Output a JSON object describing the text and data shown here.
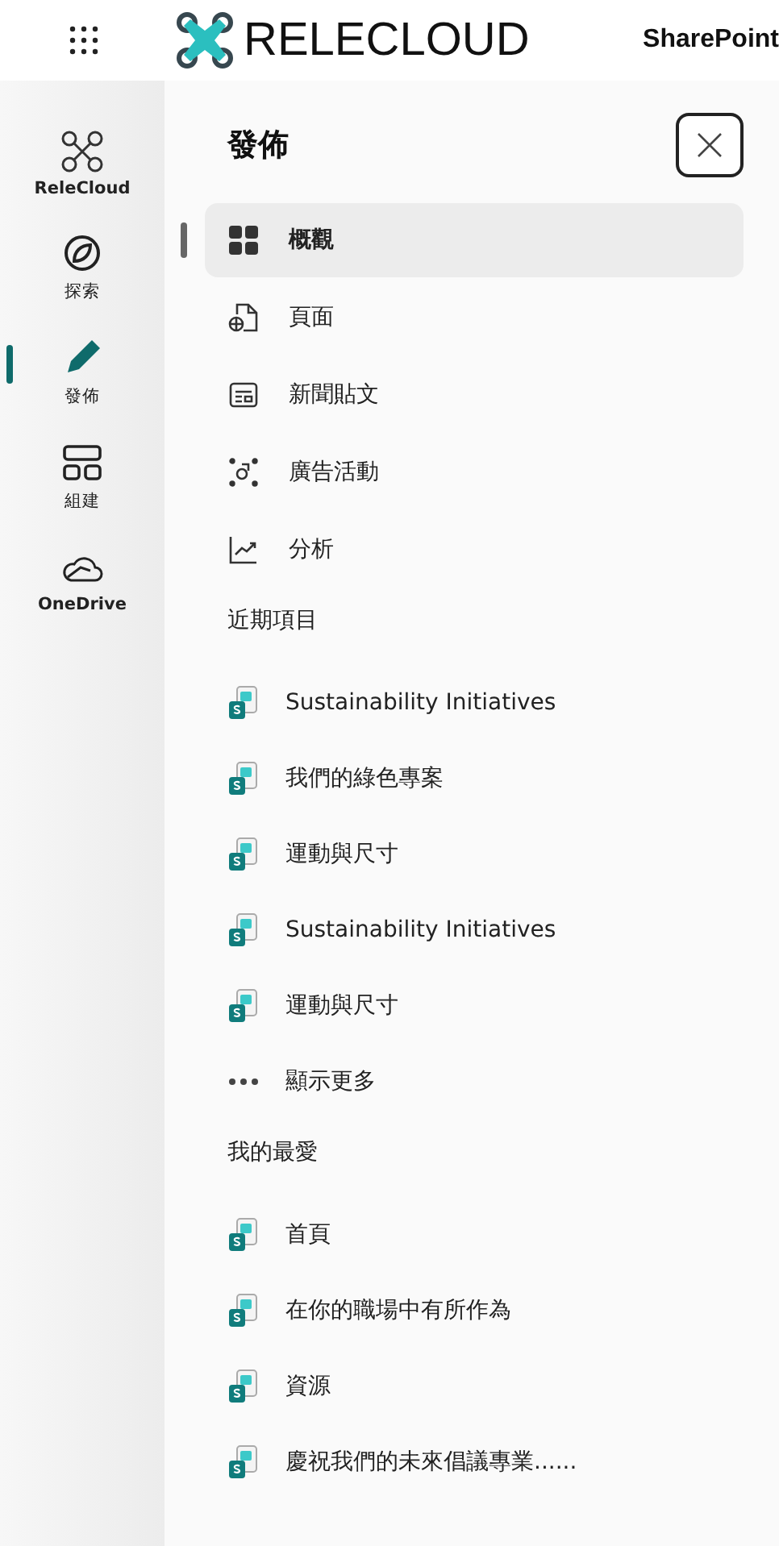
{
  "header": {
    "logo_text": "RELECLOUD",
    "product": "SharePoint"
  },
  "rail": [
    {
      "label": "ReleCloud",
      "kind": "logo",
      "selected": false
    },
    {
      "label": "探索",
      "kind": "explore",
      "selected": false
    },
    {
      "label": "發佈",
      "kind": "publish",
      "selected": true
    },
    {
      "label": "組建",
      "kind": "build",
      "selected": false
    },
    {
      "label": "OneDrive",
      "kind": "onedrive",
      "selected": false
    }
  ],
  "panel": {
    "title": "發佈",
    "nav": [
      {
        "label": "概觀",
        "kind": "overview",
        "selected": true
      },
      {
        "label": "頁面",
        "kind": "page",
        "selected": false
      },
      {
        "label": "新聞貼文",
        "kind": "news",
        "selected": false
      },
      {
        "label": "廣告活動",
        "kind": "campaign",
        "selected": false
      },
      {
        "label": "分析",
        "kind": "analytics",
        "selected": false
      }
    ],
    "sections": [
      {
        "title": "近期項目",
        "items": [
          {
            "label": "Sustainability Initiatives",
            "kind": "site"
          },
          {
            "label": "我們的綠色專案",
            "kind": "site"
          },
          {
            "label": "運動與尺寸",
            "kind": "site"
          },
          {
            "label": "Sustainability Initiatives",
            "kind": "site"
          },
          {
            "label": "運動與尺寸",
            "kind": "site"
          },
          {
            "label": "顯示更多",
            "kind": "more"
          }
        ]
      },
      {
        "title": "我的最愛",
        "items": [
          {
            "label": "首頁",
            "kind": "site"
          },
          {
            "label": "在你的職場中有所作為",
            "kind": "site"
          },
          {
            "label": "資源",
            "kind": "site"
          },
          {
            "label": "慶祝我們的未來倡議專業......",
            "kind": "site"
          }
        ]
      }
    ]
  }
}
